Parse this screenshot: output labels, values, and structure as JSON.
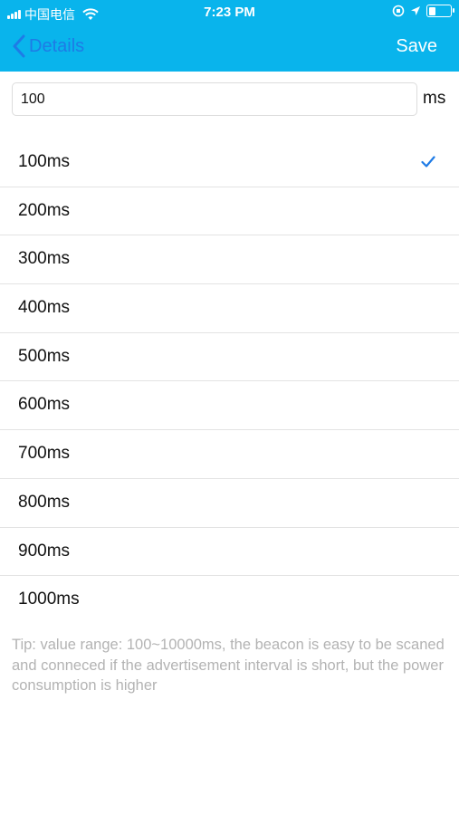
{
  "status_bar": {
    "carrier": "中国电信",
    "time": "7:23 PM",
    "battery_level": 0.35
  },
  "nav": {
    "back_label": "Details",
    "save_label": "Save"
  },
  "input": {
    "value": "100",
    "unit": "ms"
  },
  "options": [
    {
      "label": "100ms",
      "selected": true
    },
    {
      "label": "200ms",
      "selected": false
    },
    {
      "label": "300ms",
      "selected": false
    },
    {
      "label": "400ms",
      "selected": false
    },
    {
      "label": "500ms",
      "selected": false
    },
    {
      "label": "600ms",
      "selected": false
    },
    {
      "label": "700ms",
      "selected": false
    },
    {
      "label": "800ms",
      "selected": false
    },
    {
      "label": "900ms",
      "selected": false
    },
    {
      "label": "1000ms",
      "selected": false
    }
  ],
  "tip": "Tip: value range: 100~10000ms, the beacon is easy to be scaned and conneced if the advertisement interval is short, but the power consumption is higher",
  "colors": {
    "header": "#09b4ec",
    "accent": "#1e7be6",
    "tip_text": "#b3b3b3"
  }
}
